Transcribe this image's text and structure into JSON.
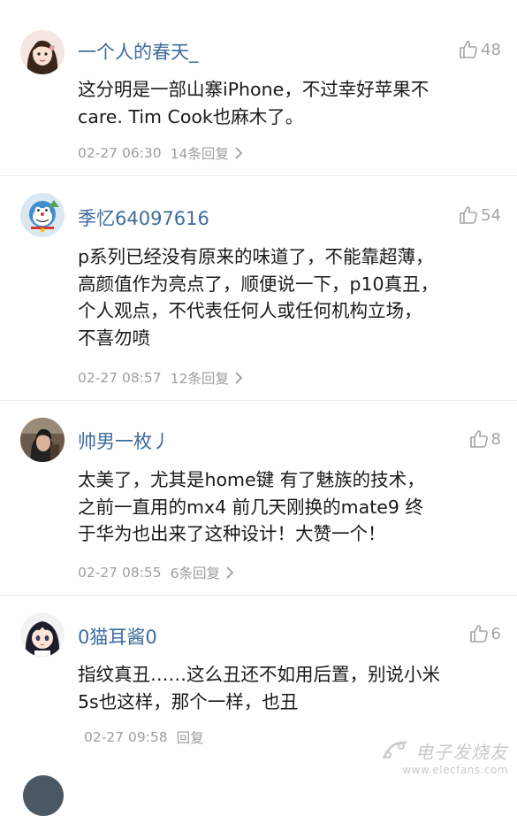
{
  "comments": [
    {
      "username": "一个人的春天_",
      "likes": "48",
      "text": "这分明是一部山寨iPhone，不过幸好苹果不care. Tim Cook也麻木了。",
      "lines": [
        "这分明是一部山寨iPhone，不过幸好苹果不",
        "care. Tim Cook也麻木了。"
      ],
      "timestamp": "02-27 06:30",
      "replies": "14条回复"
    },
    {
      "username": "季忆64097616",
      "likes": "54",
      "lines": [
        "p系列已经没有原来的味道了，不能靠超薄，",
        "高颜值作为亮点了，顺便说一下，p10真丑，",
        "个人观点，不代表任何人或任何机构立场，",
        "不喜勿喷"
      ],
      "timestamp": "02-27 08:57",
      "replies": "12条回复"
    },
    {
      "username": "帅男一枚丿",
      "likes": "8",
      "lines": [
        "太美了，尤其是home键  有了魅族的技术，",
        "之前一直用的mx4   前几天刚换的mate9   终",
        "于华为也出来了这种设计！大赞一个！"
      ],
      "timestamp": "02-27 08:55",
      "replies": "6条回复"
    },
    {
      "username": "0猫耳酱0",
      "likes": "6",
      "lines": [
        "指纹真丑……这么丑还不如用后置，别说小米",
        "5s也这样，那个一样，也丑"
      ],
      "timestamp": "02-27 09:58",
      "replies": "回复"
    }
  ],
  "watermark": {
    "name": "电子发烧友",
    "url": "www.elecfans.com"
  },
  "icons": {
    "like": "thumbs-up-icon",
    "chevron": "chevron-right-icon",
    "logo": "elecfans-logo-icon"
  },
  "colors": {
    "username": "#3d6c9e",
    "meta": "#9e9e9e",
    "like": "#a4a4a4",
    "text": "#1a1a1a"
  }
}
